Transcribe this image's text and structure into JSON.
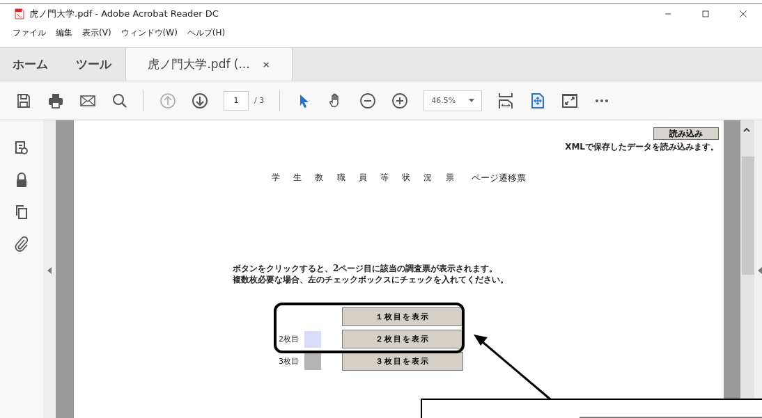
{
  "window": {
    "title": "虎ノ門大学.pdf - Adobe Acrobat Reader DC"
  },
  "menu": [
    "ファイル",
    "編集",
    "表示(V)",
    "ウィンドウ(W)",
    "ヘルプ(H)"
  ],
  "tabs": [
    {
      "label": "ホーム",
      "kind": "nav",
      "selected": false
    },
    {
      "label": "ツール",
      "kind": "nav",
      "selected": false
    },
    {
      "label": "虎ノ門大学.pdf (...",
      "kind": "document",
      "selected": true,
      "close": "×"
    }
  ],
  "toolbar": {
    "page": "1",
    "page_total": "/ 3",
    "zoom": "46.5%"
  },
  "document": {
    "load_button": "読み込み",
    "load_caption": "XMLで保存したデータを読み込みます。",
    "heading": "学生教職員等状況票",
    "subheading": "ページ遷移票",
    "instructions": [
      "ボタンをクリックすると、2ページ目に該当の調査票が表示されます。",
      "複数枚必要な場合、左のチェックボックスにチェックを入れてください。"
    ],
    "rows": [
      {
        "button": "１枚目を表示"
      },
      {
        "label": "2枚目",
        "color": "#d8dcf8",
        "button": "２枚目を表示"
      },
      {
        "label": "3枚目",
        "color": "#b4b4b4",
        "button": "３枚目を表示"
      }
    ]
  }
}
